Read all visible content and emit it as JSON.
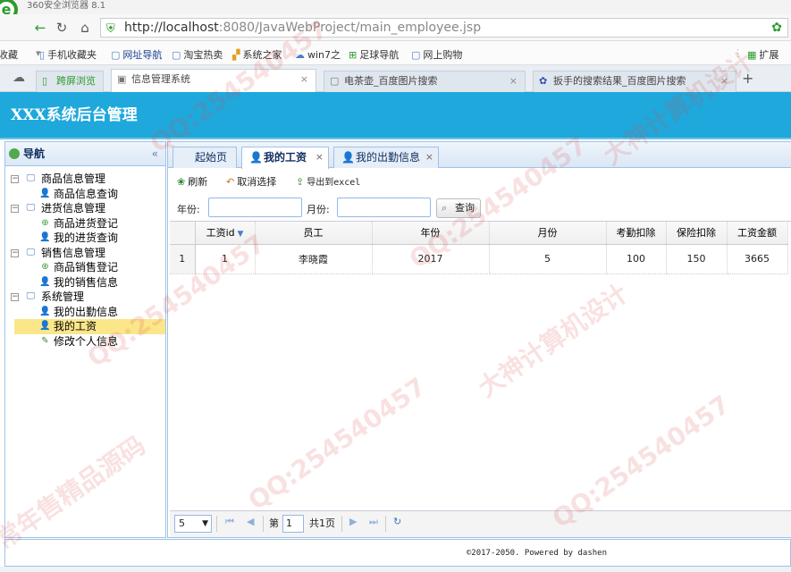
{
  "browser": {
    "app_name": "360安全浏览器 8.1",
    "url_host": "localhost",
    "url_rest": ":8080/JavaWebProject/main_employee.jsp",
    "bookmarks": [
      "收藏",
      "手机收藏夹",
      "网址导航",
      "淘宝热卖",
      "系统之家",
      "win7之",
      "足球导航",
      "网上购物",
      "扩展"
    ],
    "tabs": [
      {
        "label": "跨屏浏览"
      },
      {
        "label": "信息管理系统"
      },
      {
        "label": "电茶壶_百度图片搜索"
      },
      {
        "label": "扳手的搜索结果_百度图片搜索"
      }
    ]
  },
  "header": {
    "title": "XXX系统后台管理"
  },
  "sidebar": {
    "title": "导航",
    "collapse_glyph": "«",
    "groups": [
      {
        "label": "商品信息管理",
        "children": [
          "商品信息查询"
        ]
      },
      {
        "label": "进货信息管理",
        "children": [
          "商品进货登记",
          "我的进货查询"
        ]
      },
      {
        "label": "销售信息管理",
        "children": [
          "商品销售登记",
          "我的销售信息"
        ]
      },
      {
        "label": "系统管理",
        "children": [
          "我的出勤信息",
          "我的工资",
          "修改个人信息"
        ]
      }
    ]
  },
  "content_tabs": [
    {
      "label": "起始页"
    },
    {
      "label": "我的工资"
    },
    {
      "label": "我的出勤信息"
    }
  ],
  "toolbar": {
    "refresh": "刷新",
    "unselect": "取消选择",
    "export": "导出到excel"
  },
  "search": {
    "year_label": "年份:",
    "month_label": "月份:",
    "year_value": "",
    "month_value": "",
    "query": "查询"
  },
  "grid": {
    "columns": [
      "工资id",
      "员工",
      "年份",
      "月份",
      "考勤扣除",
      "保险扣除",
      "工资金额"
    ],
    "rows": [
      {
        "rownum": "1",
        "cells": [
          "1",
          "李晓霞",
          "2017",
          "5",
          "100",
          "150",
          "3665"
        ]
      }
    ]
  },
  "pager": {
    "page_size": "5",
    "page_prefix": "第",
    "page_value": "1",
    "page_suffix": "共1页"
  },
  "footer": {
    "text": "©2017-2050. Powered by dashen"
  },
  "watermarks": [
    "QQ:254540457",
    "大神计算机设计",
    "常年售精品源码"
  ]
}
